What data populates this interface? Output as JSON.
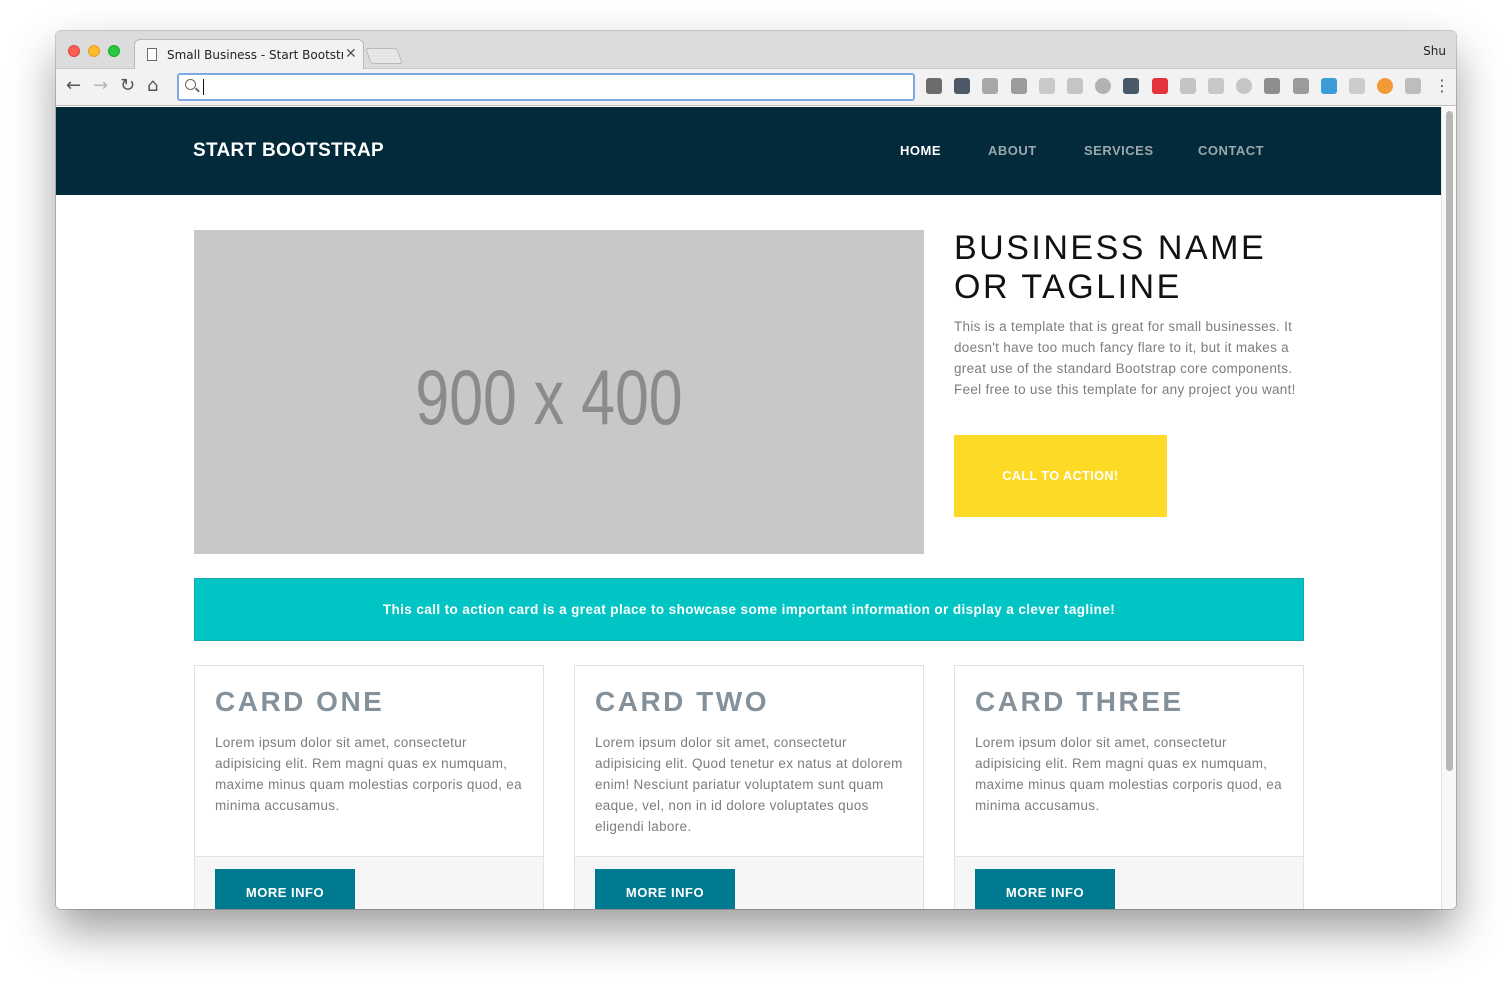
{
  "browser": {
    "tab_title": "Small Business - Start Bootstrap",
    "tab_close": "✕",
    "profile_name": "Shu",
    "omnibox_value": "",
    "nav": {
      "back": "←",
      "forward": "→",
      "reload": "↻",
      "home": "⌂",
      "menu": "⋮"
    },
    "extensions": [
      {
        "name": "pen-icon",
        "color": "#555555"
      },
      {
        "name": "screenshot-icon",
        "color": "#2f3f4f"
      },
      {
        "name": "drive-icon",
        "color": "#9a9a9a"
      },
      {
        "name": "camera-ext-icon",
        "color": "#8d8d8d"
      },
      {
        "name": "react-icon",
        "color": "#c2c2c2"
      },
      {
        "name": "grid-icon",
        "color": "#bdbdbd"
      },
      {
        "name": "circle-icon",
        "color": "#a7a7a7"
      },
      {
        "name": "angular-icon",
        "color": "#2c3e50"
      },
      {
        "name": "adblock-icon",
        "color": "#e3131b"
      },
      {
        "name": "video-icon",
        "color": "#bcbcbc"
      },
      {
        "name": "u-icon",
        "color": "#bfbfbf"
      },
      {
        "name": "ring-icon",
        "color": "#bdbdbd"
      },
      {
        "name": "vue-icon",
        "color": "#7c7c7c"
      },
      {
        "name": "photo-icon",
        "color": "#8c8c8c"
      },
      {
        "name": "windows-icon",
        "color": "#1b8ed3"
      },
      {
        "name": "dots-icon",
        "color": "#c6c6c6"
      },
      {
        "name": "lastpass-icon",
        "color": "#f28b16"
      },
      {
        "name": "dropbox-icon",
        "color": "#b4b4b4"
      }
    ]
  },
  "site": {
    "brand": "START BOOTSTRAP",
    "nav": [
      {
        "label": "HOME",
        "active": true
      },
      {
        "label": "ABOUT",
        "active": false
      },
      {
        "label": "SERVICES",
        "active": false
      },
      {
        "label": "CONTACT",
        "active": false
      }
    ],
    "hero": {
      "image_placeholder": "900 x 400",
      "title": "BUSINESS NAME OR TAGLINE",
      "description": "This is a template that is great for small businesses. It doesn't have too much fancy flare to it, but it makes a great use of the standard Bootstrap core components. Feel free to use this template for any project you want!",
      "cta": "CALL TO ACTION!"
    },
    "callout": "This call to action card is a great place to showcase some important information or display a clever tagline!",
    "cards": [
      {
        "title": "CARD ONE",
        "text": "Lorem ipsum dolor sit amet, consectetur adipisicing elit. Rem magni quas ex numquam, maxime minus quam molestias corporis quod, ea minima accusamus.",
        "button": "MORE INFO"
      },
      {
        "title": "CARD TWO",
        "text": "Lorem ipsum dolor sit amet, consectetur adipisicing elit. Quod tenetur ex natus at dolorem enim! Nesciunt pariatur voluptatem sunt quam eaque, vel, non in id dolore voluptates quos eligendi labore.",
        "button": "MORE INFO"
      },
      {
        "title": "CARD THREE",
        "text": "Lorem ipsum dolor sit amet, consectetur adipisicing elit. Rem magni quas ex numquam, maxime minus quam molestias corporis quod, ea minima accusamus.",
        "button": "MORE INFO"
      }
    ]
  },
  "colors": {
    "navbar": "#032a3a",
    "cta": "#fdda26",
    "callout": "#00c5c4",
    "button": "#007a90",
    "placeholder": "#c8c8c8"
  }
}
